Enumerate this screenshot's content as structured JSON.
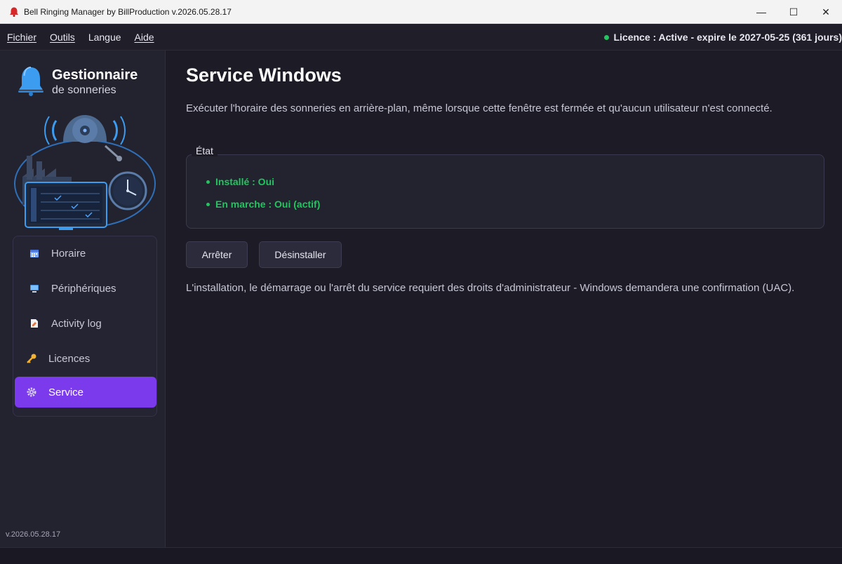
{
  "window": {
    "title": "Bell Ringing Manager by BillProduction v.2026.05.28.17",
    "minimize_glyph": "—",
    "maximize_glyph": "☐",
    "close_glyph": "✕"
  },
  "menu": {
    "items": [
      {
        "label": "Fichier"
      },
      {
        "label": "Outils"
      },
      {
        "label": "Langue"
      },
      {
        "label": "Aide"
      }
    ],
    "licence_status": "Licence : Active - expire le 2027-05-25 (361 jours)",
    "licence_status_color": "#22c55e"
  },
  "sidebar": {
    "brand_title": "Gestionnaire",
    "brand_subtitle": "de sonneries",
    "illustration_icons": [
      "bell-icon",
      "factory-icon",
      "clock-icon",
      "monitor-icon"
    ],
    "items": [
      {
        "label": "Horaire",
        "icon": "calendar-icon",
        "active": false
      },
      {
        "label": "Périphériques",
        "icon": "monitor-icon",
        "active": false
      },
      {
        "label": "Activity log",
        "icon": "log-document-icon",
        "active": false
      },
      {
        "label": "Licences",
        "icon": "key-icon",
        "active": false
      },
      {
        "label": "Service",
        "icon": "gear-icon",
        "active": true
      }
    ],
    "active_color": "#7c3aed",
    "version": "v.2026.05.28.17"
  },
  "main": {
    "title": "Service Windows",
    "description": "Exécuter l'horaire des sonneries en arrière-plan, même lorsque cette fenêtre est fermée et qu'aucun utilisateur n'est connecté.",
    "state_group": {
      "legend": "État",
      "lines": [
        {
          "text": "Installé : Oui"
        },
        {
          "text": "En marche : Oui (actif)"
        }
      ],
      "ok_color": "#22c55e"
    },
    "buttons": {
      "stop_label": "Arrêter",
      "uninstall_label": "Désinstaller"
    },
    "note": "L'installation, le démarrage ou l'arrêt du service requiert des droits d'administrateur - Windows demandera une confirmation (UAC)."
  }
}
